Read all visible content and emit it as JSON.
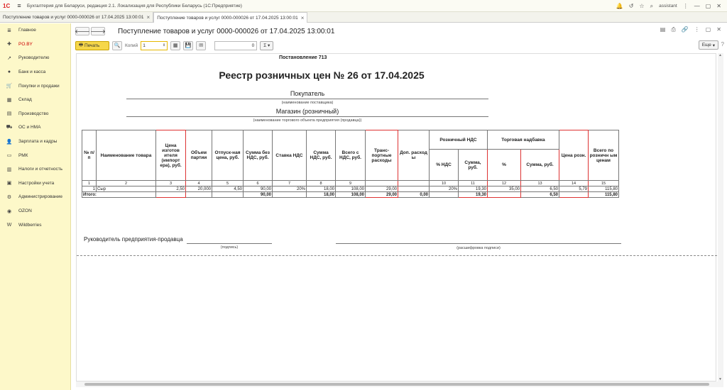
{
  "app": {
    "logo": "1С",
    "title": "Бухгалтерия для Беларуси, редакция 2.1. Локализация для Республики Беларусь   (1С:Предприятие)",
    "user": "assistant"
  },
  "tabs": [
    {
      "label": "Поступление товаров и услуг 0000-000026 от 17.04.2025 13:00:01"
    },
    {
      "label": "Поступление товаров и услуг 0000-000026 от 17.04.2025 13:00:01"
    }
  ],
  "sidebar": [
    {
      "label": "Главное",
      "icon": "≣"
    },
    {
      "label": "PO.BY",
      "icon": "✚"
    },
    {
      "label": "Руководителю",
      "icon": "↗"
    },
    {
      "label": "Банк и касса",
      "icon": "●"
    },
    {
      "label": "Покупки и продажи",
      "icon": "🛒"
    },
    {
      "label": "Склад",
      "icon": "▦"
    },
    {
      "label": "Производство",
      "icon": "▤"
    },
    {
      "label": "ОС и НМА",
      "icon": "⛟"
    },
    {
      "label": "Зарплата и кадры",
      "icon": "👤"
    },
    {
      "label": "РМК",
      "icon": "▭"
    },
    {
      "label": "Налоги и отчетность",
      "icon": "▥"
    },
    {
      "label": "Настройки учета",
      "icon": "▣"
    },
    {
      "label": "Администрирование",
      "icon": "⚙"
    },
    {
      "label": "OZON",
      "icon": "◉"
    },
    {
      "label": "Wildberries",
      "icon": "W"
    }
  ],
  "doc": {
    "title": "Поступление товаров и услуг 0000-000026 от 17.04.2025 13:00:01"
  },
  "toolbar": {
    "print": "Печать",
    "copies_label": "Копий",
    "copies_value": "1",
    "num_value": "0",
    "sigma": "Σ",
    "more": "Еще"
  },
  "report": {
    "decree": "Постановление 713",
    "title": "Реестр розничных цен № 26 от 17.04.2025",
    "buyer": "Покупатель",
    "buyer_caption": "(наименование поставщика)",
    "store": "Магазин (розничный)",
    "store_caption": "(наименование торгового объекта предприятия (продавца))",
    "headers": {
      "npp": "№ п/п",
      "name": "Наименование товара",
      "price_mfr": "Цена изготов ителя (импорт ера), руб.",
      "volume": "Объем партии",
      "sale_price": "Отпуск-ная цена, руб.",
      "sum_no_vat": "Сумма без НДС, руб.",
      "vat_rate": "Ставка НДС",
      "vat_sum": "Сумма НДС, руб.",
      "total_vat": "Всего с НДС, руб.",
      "transport": "Транс-портные расходы",
      "extra": "Доп. расход ы",
      "retail_vat": "Розничный НДС",
      "retail_vat_pct": "% НДС",
      "retail_vat_sum": "Сумма, руб.",
      "markup": "Торговая надбавка",
      "markup_pct": "%",
      "markup_sum": "Сумма, руб.",
      "retail_price": "Цена розн.",
      "total_retail": "Всего по розничн ым ценам"
    },
    "col_numbers": [
      "1",
      "2",
      "3",
      "4",
      "5",
      "6",
      "7",
      "8",
      "9",
      "",
      "",
      "10",
      "11",
      "12",
      "13",
      "14",
      "15"
    ],
    "row": {
      "n": "1",
      "name": "Сыр",
      "price_mfr": "2,50",
      "volume": "20,000",
      "sale_price": "4,50",
      "sum_no_vat": "90,00",
      "vat_rate": "20%",
      "vat_sum": "18,00",
      "total_vat": "108,00",
      "transport": "29,00",
      "extra": "",
      "rvat_pct": "20%",
      "rvat_sum": "19,30",
      "markup_pct": "35,00",
      "markup_sum": "6,50",
      "retail_price": "5,79",
      "total_retail": "115,80"
    },
    "totals": {
      "label": "Итого:",
      "sum_no_vat": "90,00",
      "vat_sum": "18,00",
      "total_vat": "108,00",
      "transport": "29,00",
      "extra": "0,00",
      "rvat_sum": "19,30",
      "markup_sum": "6,50",
      "total_retail": "115,80"
    },
    "signature": {
      "role": "Руководитель предприятия-продавца",
      "sign_caption": "(подпись)",
      "decode_caption": "(расшифровка подписи)"
    }
  }
}
